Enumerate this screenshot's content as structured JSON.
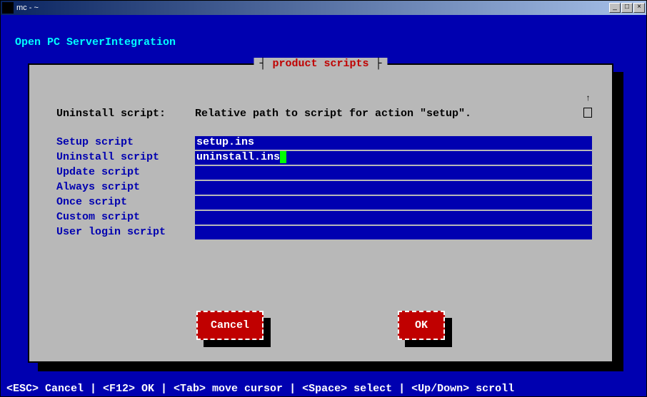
{
  "window": {
    "title": "mc - ~"
  },
  "header": "Open PC ServerIntegration",
  "dialog": {
    "title": "product scripts",
    "desc_label": "Uninstall script:",
    "desc_text": "Relative path to script for action \"setup\".",
    "fields": [
      {
        "label": "Setup script",
        "value": "setup.ins",
        "cursor": false
      },
      {
        "label": "Uninstall script",
        "value": "uninstall.ins",
        "cursor": true
      },
      {
        "label": "Update script",
        "value": "",
        "cursor": false
      },
      {
        "label": "Always script",
        "value": "",
        "cursor": false
      },
      {
        "label": "Once script",
        "value": "",
        "cursor": false
      },
      {
        "label": "Custom script",
        "value": "",
        "cursor": false
      },
      {
        "label": "User login script",
        "value": "",
        "cursor": false
      }
    ],
    "buttons": {
      "cancel": "Cancel",
      "ok": "OK"
    }
  },
  "statusbar": "<ESC> Cancel | <F12> OK | <Tab> move cursor | <Space> select | <Up/Down> scroll"
}
